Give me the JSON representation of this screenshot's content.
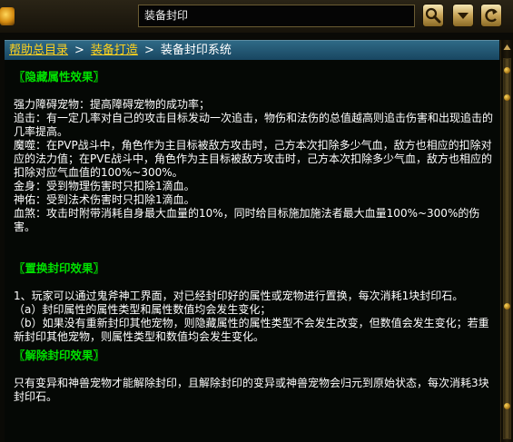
{
  "search": {
    "value": "装备封印"
  },
  "icons": {
    "logo": "gold-gem-icon",
    "search": "magnifier-icon",
    "dropdown": "chevron-down-icon",
    "back": "back-arrow-icon",
    "scroll_up": "arrow-up-icon"
  },
  "breadcrumb": {
    "items": [
      {
        "label": "帮助总目录",
        "link": true
      },
      {
        "label": "装备打造",
        "link": true
      },
      {
        "label": "装备封印系统",
        "link": false
      }
    ],
    "separator": ">"
  },
  "content": {
    "hidden_attr": {
      "heading": "〖隐藏属性效果〗",
      "lines": [
        "强力障碍宠物：提高障碍宠物的成功率；",
        "追击：有一定几率对自己的攻击目标发动一次追击，物伤和法伤的总值越高则追击伤害和出现追击的几率提高。",
        "魔噬：在PVP战斗中，角色作为主目标被敌方攻击时，己方本次扣除多少气血，敌方也相应的扣除对应的法力值；在PVE战斗中，角色作为主目标被敌方攻击时，己方本次扣除多少气血，敌方也相应的扣除对应气血值的100%~300%。",
        "金身：受到物理伤害时只扣除1滴血。",
        "神佑：受到法术伤害时只扣除1滴血。",
        "血煞：攻击时附带消耗自身最大血量的10%，同时给目标施加施法者最大血量100%~300%的伤害。"
      ]
    },
    "replace_seal": {
      "heading": "〖置换封印效果〗",
      "lines": [
        "1、玩家可以通过鬼斧神工界面，对已经封印好的属性或宠物进行置换，每次消耗1块封印石。",
        "（a）封印属性的属性类型和属性数值均会发生变化；",
        "（b）如果没有重新封印其他宠物，则隐藏属性的属性类型不会发生改变，但数值会发生变化；若重新封印其他宠物，则属性类型和数值均会发生变化。"
      ]
    },
    "remove_seal": {
      "heading": "〖解除封印效果〗",
      "lines": [
        "只有变异和神兽宠物才能解除封印，且解除封印的变异或神兽宠物会归元到原始状态，每次消耗3块封印石。"
      ]
    }
  },
  "colors": {
    "heading": "#00e000",
    "link": "#ffd21e",
    "text": "#ffffff",
    "breadcrumb_bg": "#2f6a86"
  }
}
